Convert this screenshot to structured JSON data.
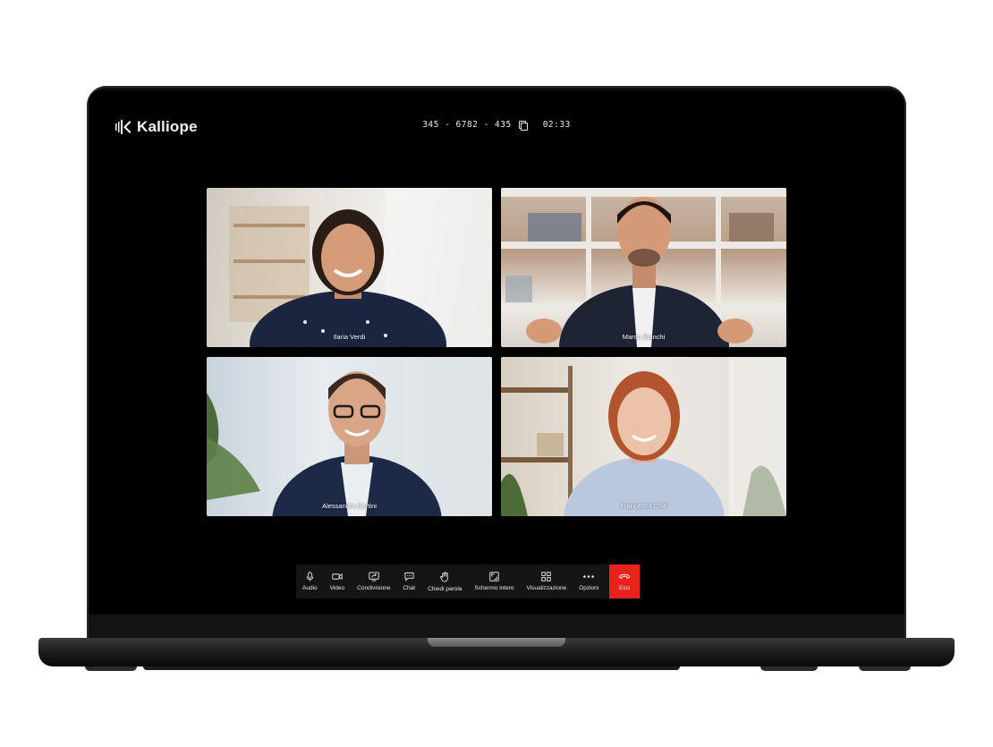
{
  "app": {
    "logo_text": "Kalliope"
  },
  "meeting": {
    "code": "345 - 6782 - 435",
    "timer": "02:33"
  },
  "participants": [
    {
      "name": "Ilaria Verdi"
    },
    {
      "name": "Marco Bianchi"
    },
    {
      "name": "Alessandro Bertini"
    },
    {
      "name": "Francesca Chiti"
    }
  ],
  "toolbar": {
    "audio": "Audio",
    "video": "Video",
    "share": "Condivisione",
    "chat": "Chat",
    "raise_hand": "Chiedi parola",
    "fullscreen": "Schermo intero",
    "view": "Visualizzazione",
    "options": "Opzioni",
    "leave": "Esci"
  },
  "colors": {
    "leave": "#e8231c",
    "toolbar_bg": "#151515",
    "screen_bg": "#000000"
  }
}
